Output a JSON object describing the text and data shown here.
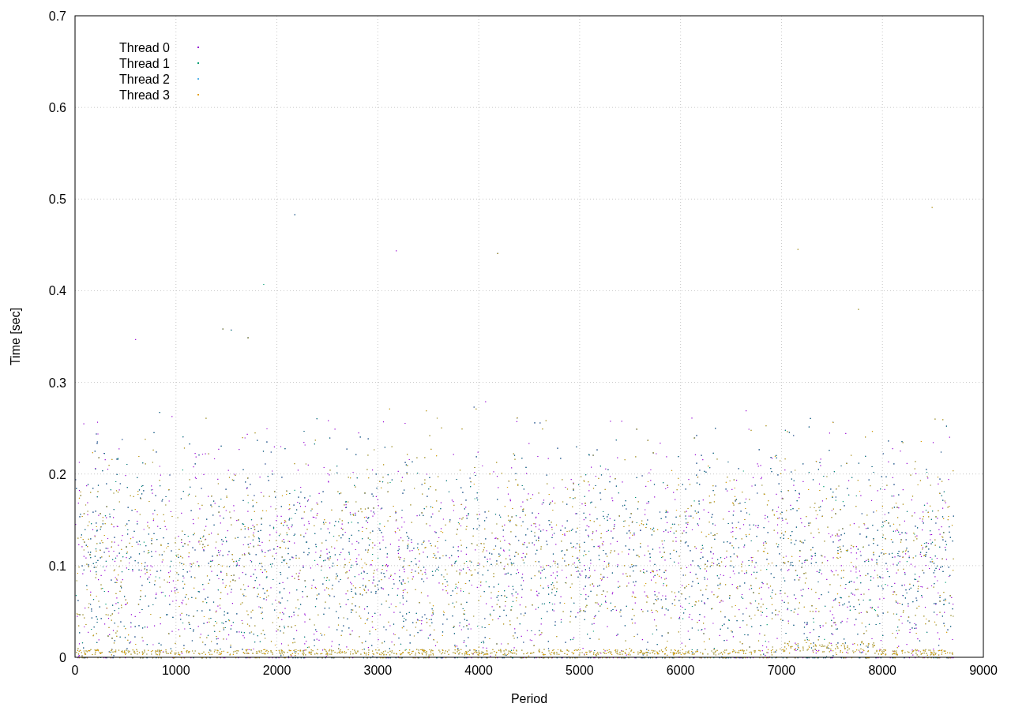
{
  "plot": {
    "y_axis_label": "Time [sec]",
    "x_axis_label": "Period",
    "y_tick_labels": [
      "0.7",
      "0.6",
      "0.5",
      "0.4",
      "0.3",
      "0.2",
      "0.1",
      "0"
    ],
    "x_tick_labels": [
      "0",
      "1000",
      "2000",
      "3000",
      "4000",
      "5000",
      "6000",
      "7000",
      "8000",
      "9000"
    ],
    "legend": [
      {
        "label": "Thread 0",
        "color": "#9400d3"
      },
      {
        "label": "Thread 1",
        "color": "#009e73"
      },
      {
        "label": "Thread 2",
        "color": "#56b4e9"
      },
      {
        "label": "Thread 3",
        "color": "#e69f00"
      }
    ]
  }
}
